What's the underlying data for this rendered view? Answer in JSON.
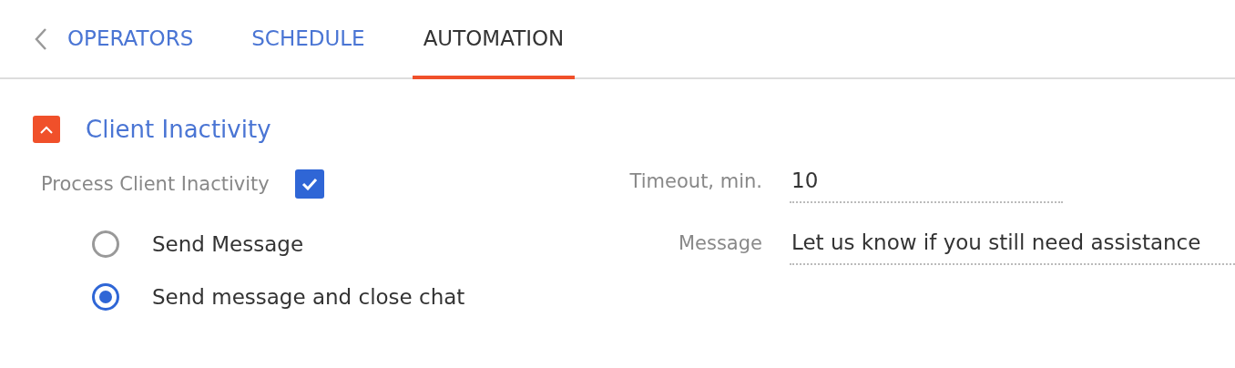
{
  "tabs": [
    {
      "label": "OPERATORS",
      "selected": false
    },
    {
      "label": "SCHEDULE",
      "selected": false
    },
    {
      "label": "AUTOMATION",
      "selected": true
    }
  ],
  "section": {
    "title": "Client Inactivity",
    "expanded": true
  },
  "process": {
    "label": "Process Client Inactivity",
    "checked": true
  },
  "options": [
    {
      "label": "Send Message",
      "selected": false
    },
    {
      "label": "Send message and close chat",
      "selected": true
    }
  ],
  "fields": [
    {
      "label": "Timeout, min.",
      "value": "10",
      "kind": "short"
    },
    {
      "label": "Message",
      "value": "Let us know if you still need assistance",
      "kind": "wide"
    }
  ]
}
